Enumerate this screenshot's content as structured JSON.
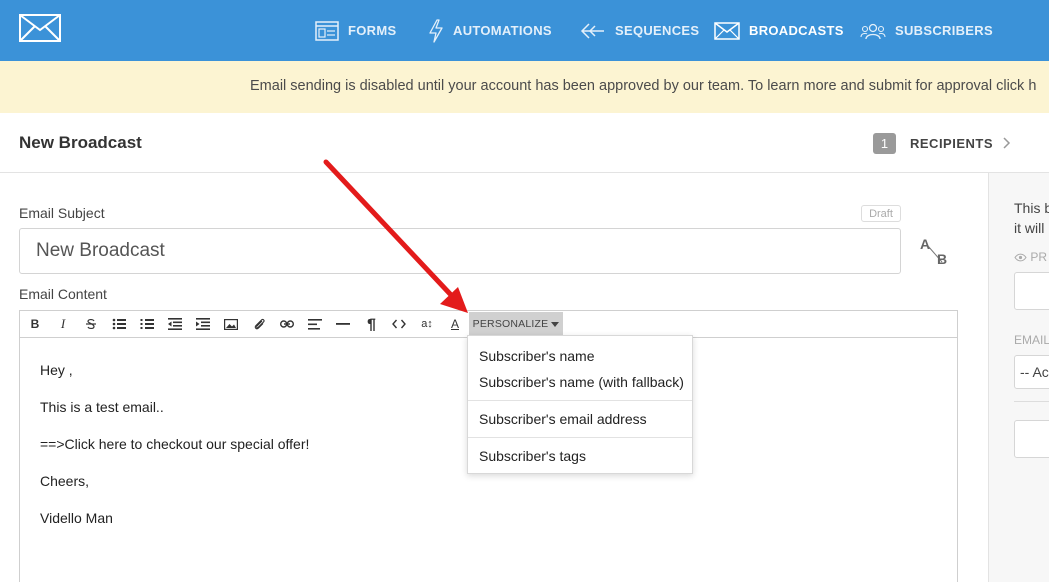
{
  "nav": {
    "items": [
      {
        "label": "FORMS",
        "icon": "form-icon"
      },
      {
        "label": "AUTOMATIONS",
        "icon": "lightning-icon"
      },
      {
        "label": "SEQUENCES",
        "icon": "sequence-arrows-icon"
      },
      {
        "label": "BROADCASTS",
        "icon": "envelope-icon"
      },
      {
        "label": "SUBSCRIBERS",
        "icon": "users-icon"
      }
    ]
  },
  "banner": {
    "text": "Email sending is disabled until your account has been approved by our team. To learn more and submit for approval click h"
  },
  "header": {
    "title": "New Broadcast",
    "step_number": "1",
    "step_label": "RECIPIENTS"
  },
  "form": {
    "subject_label": "Email Subject",
    "draft_badge": "Draft",
    "subject_value": "New Broadcast",
    "ab_a": "A",
    "ab_b": "B",
    "content_label": "Email Content"
  },
  "toolbar": {
    "bold": "B",
    "italic": "I",
    "text_size": "a↕",
    "font_color": "A",
    "personalize_label": "PERSONALIZE"
  },
  "content": {
    "lines": [
      "Hey ,",
      "This is a test email..",
      "==>Click here to checkout our special offer!",
      "Cheers,",
      "Vidello Man"
    ]
  },
  "dropdown": {
    "items": [
      "Subscriber's name",
      "Subscriber's name (with fallback)",
      "Subscriber's email address",
      "Subscriber's tags"
    ]
  },
  "right_panel": {
    "line1": "This b",
    "line2": "it will",
    "preview_label": "PR",
    "email_label": "EMAIL",
    "select_value": "-- Ac"
  },
  "colors": {
    "nav_bg": "#3b92d8",
    "banner_bg": "#fcf4d2",
    "arrow": "#e31b1b"
  }
}
